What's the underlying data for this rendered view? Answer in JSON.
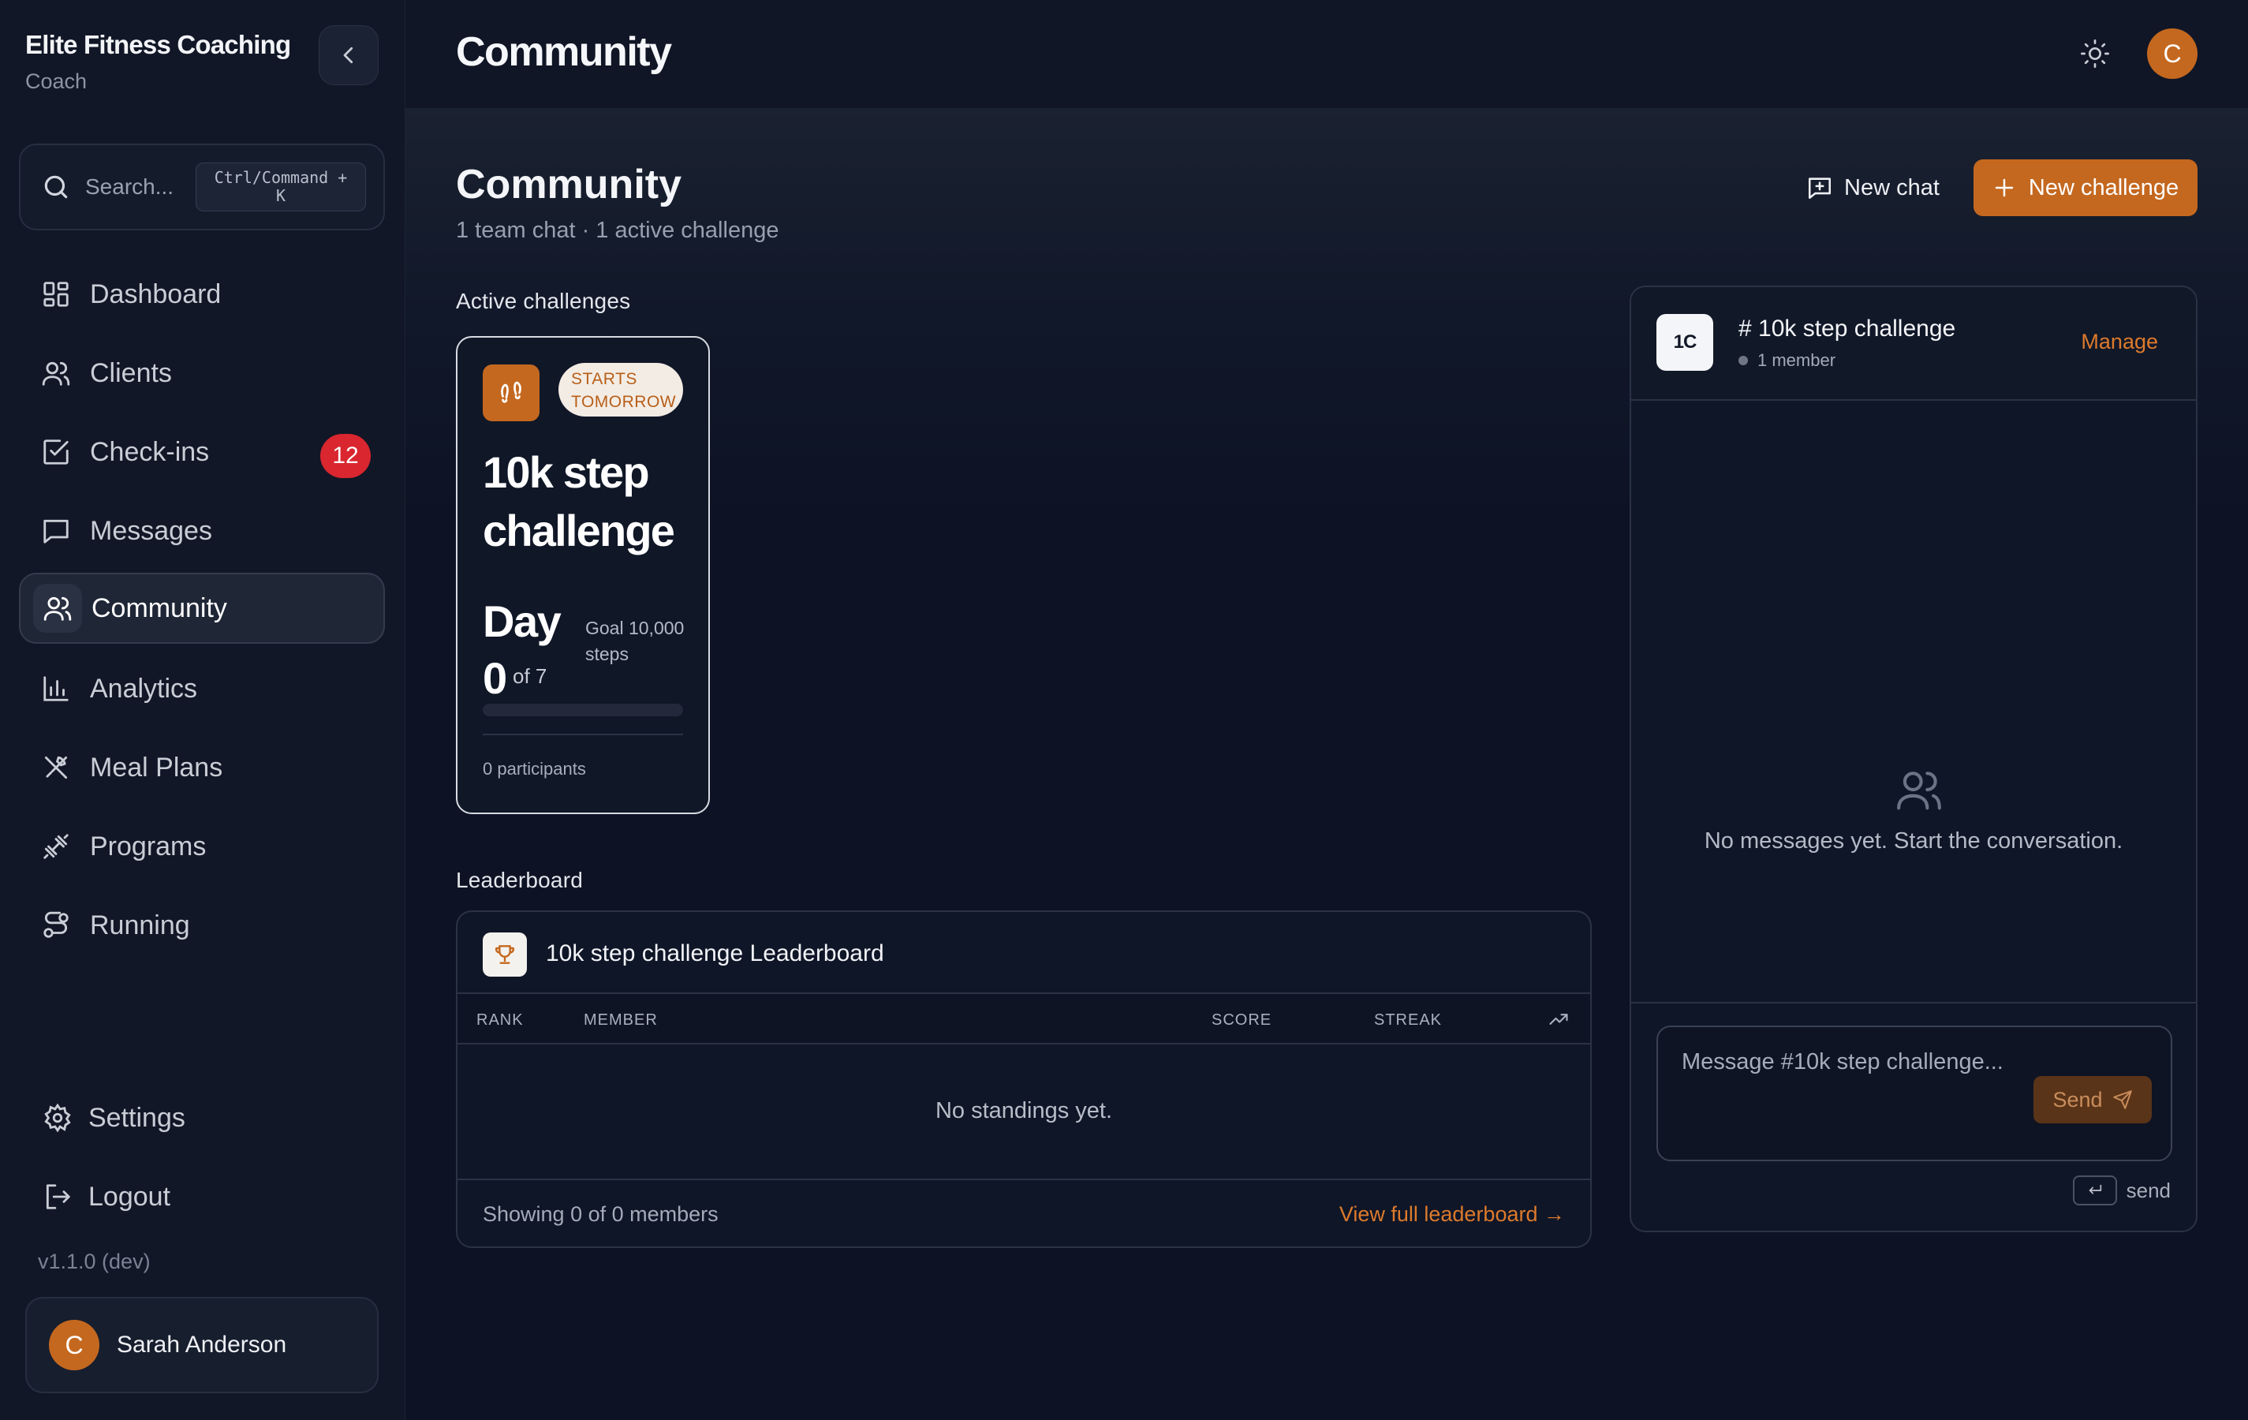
{
  "sidebar": {
    "brand_title": "Elite Fitness Coaching",
    "brand_sub": "Coach",
    "search_label": "Search...",
    "search_shortcut": "Ctrl/Command +\nK",
    "nav": [
      {
        "label": "Dashboard",
        "icon": "dashboard-grid-icon"
      },
      {
        "label": "Clients",
        "icon": "users-icon"
      },
      {
        "label": "Check-ins",
        "icon": "checkbox-icon",
        "badge": "12"
      },
      {
        "label": "Messages",
        "icon": "message-square-icon"
      },
      {
        "label": "Community",
        "icon": "users-icon",
        "active": true
      },
      {
        "label": "Analytics",
        "icon": "bar-chart-icon"
      },
      {
        "label": "Meal Plans",
        "icon": "utensils-icon"
      },
      {
        "label": "Programs",
        "icon": "dumbbell-icon"
      },
      {
        "label": "Running",
        "icon": "route-icon"
      }
    ],
    "settings_label": "Settings",
    "logout_label": "Logout",
    "version": "v1.1.0 (dev)",
    "user": {
      "initial": "C",
      "name": "Sarah Anderson"
    }
  },
  "header": {
    "title": "Community",
    "avatar_initial": "C"
  },
  "main": {
    "title": "Community",
    "subtitle": "1 team chat · 1 active challenge",
    "new_chat_label": "New chat",
    "new_challenge_label": "New challenge",
    "active_challenges_label": "Active challenges",
    "leaderboard_label": "Leaderboard",
    "challenge": {
      "status": "STARTS TOMORROW",
      "title": "10k step challenge",
      "day_label": "Day",
      "day_value": "0",
      "of_label": "of 7",
      "goal_label": "Goal 10,000 steps",
      "progress_fraction": 0,
      "participants": "0 participants"
    },
    "leaderboard": {
      "title": "10k step challenge Leaderboard",
      "columns": [
        "RANK",
        "MEMBER",
        "SCORE",
        "STREAK"
      ],
      "empty_text": "No standings yet.",
      "showing": "Showing 0 of 0 members",
      "view_all": "View full leaderboard →"
    },
    "chat": {
      "avatar_text": "1C",
      "name": "# 10k step challenge",
      "members": "1 member",
      "manage_label": "Manage",
      "empty_text": "No messages yet. Start the conversation.",
      "placeholder": "Message #10k step challenge...",
      "send_label": "Send",
      "enter_hint": "send"
    }
  },
  "colors": {
    "accent": "#c4681f",
    "badge": "#d9262f",
    "background": "#0d1324"
  }
}
